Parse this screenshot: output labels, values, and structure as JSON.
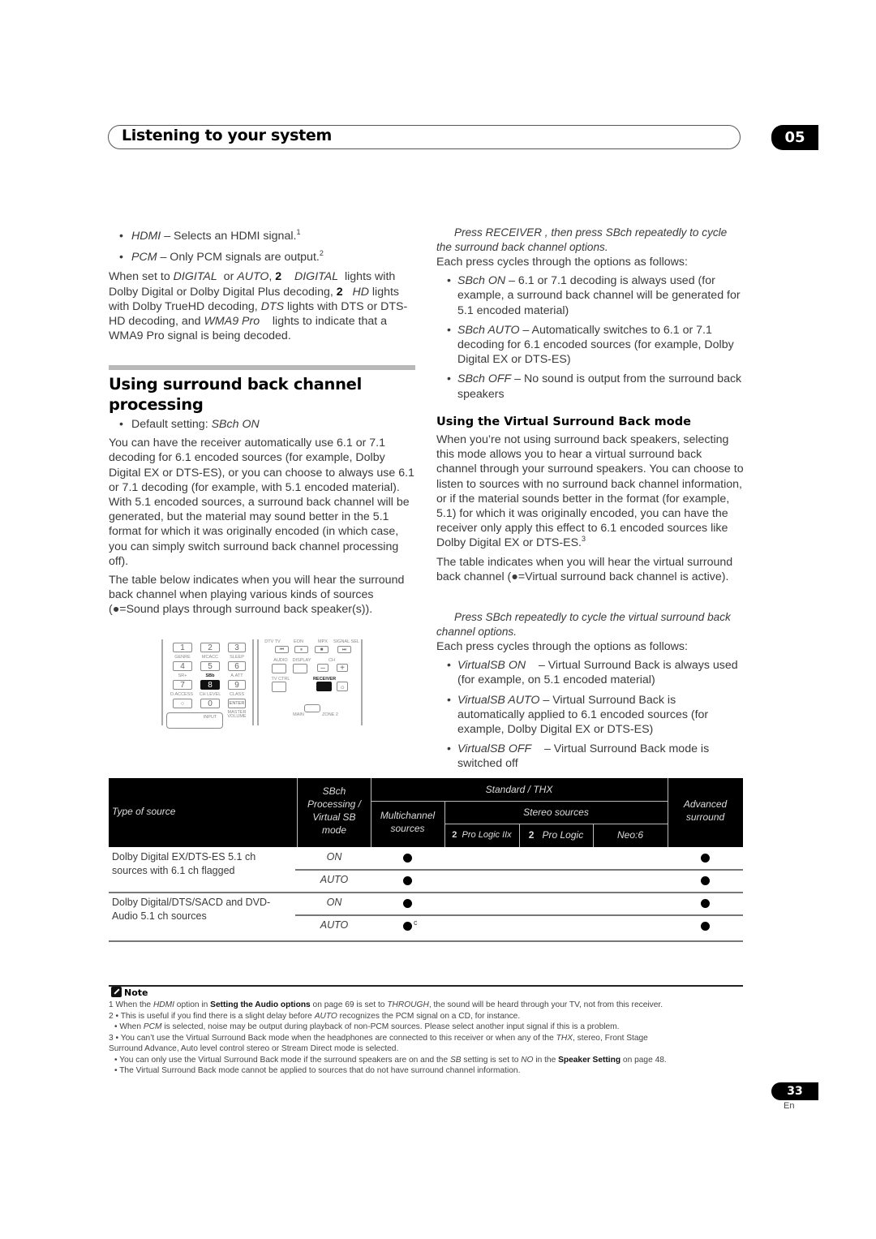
{
  "header": {
    "title": "Listening to your system",
    "chapter": "05"
  },
  "left": {
    "bullets_top": [
      {
        "term": "HDMI",
        "text": " – Selects an HDMI signal.",
        "sup": "1"
      },
      {
        "term": "PCM",
        "text": " – Only PCM signals are output.",
        "sup": "2"
      }
    ],
    "digital_para": {
      "p1": "When set to ",
      "t1": "DIGITAL",
      "p2": "  or ",
      "t2": "AUTO",
      "p3": ", ",
      "b1": "2",
      "p4": "    ",
      "t3": "DIGITAL",
      "p5": "  lights with Dolby Digital or Dolby Digital Plus decoding, ",
      "b2": "2",
      "p6": "   ",
      "t4": "HD",
      "p7": " lights with Dolby TrueHD decoding, ",
      "t5": "DTS",
      "p8": " lights with DTS or DTS-HD decoding, and ",
      "t6": "WMA9 Pro",
      "p9": "    lights to indicate that a WMA9 Pro signal is being decoded."
    },
    "section_title": "Using surround back channel processing",
    "default_setting_label": "Default setting: ",
    "default_setting_value": "SBch ON",
    "para1": "You can have the receiver automatically use 6.1 or 7.1 decoding for 6.1 encoded sources (for example, Dolby Digital EX or DTS-ES), or you can choose to always use 6.1 or 7.1 decoding (for example, with 5.1 encoded material). With 5.1 encoded sources, a surround back channel will be generated, but the material may sound better in the 5.1 format for which it was originally encoded (in which case, you can simply switch surround back channel processing off).",
    "para2": "The table below indicates when you will hear the surround back channel when playing various kinds of sources (●=Sound plays through surround back speaker(s))."
  },
  "remote": {
    "keys": [
      "1",
      "2",
      "3",
      "4",
      "5",
      "6",
      "7",
      "8",
      "9",
      "○",
      "0",
      "ENTER"
    ],
    "labels": [
      "GENRE",
      "MCACC",
      "SLEEP",
      "SR+",
      "SBb",
      "A.ATT",
      "D.ACCESS",
      "CH LEVEL",
      "CLASS",
      "INPUT",
      "MASTER VOLUME"
    ],
    "right_labels": [
      "DTV TV",
      "EON",
      "MPX",
      "SIGNAL SEL",
      "AUDIO",
      "DISPLAY",
      "CH",
      "TV CTRL",
      "RECEIVER",
      "MAIN",
      "ZONE 2"
    ],
    "transport_glyphs": [
      "⏮",
      "⏸",
      "■",
      "⏭"
    ],
    "ch_minus": "–",
    "ch_plus": "+",
    "light_icon": "☼"
  },
  "right": {
    "step1": {
      "p1": "Press ",
      "t1": "RECEIVER",
      "p2": " , then press ",
      "t2": "SBch",
      "p3": " repeatedly to cycle the surround back channel options."
    },
    "each_press": "Each press cycles through the options as follows:",
    "sbch_options": [
      {
        "term": "SBch ON",
        "text": "  – 6.1 or 7.1 decoding is always used (for example, a surround back channel will be generated for 5.1 encoded material)"
      },
      {
        "term": "SBch AUTO",
        "text": "  – Automatically switches to 6.1 or 7.1 decoding for 6.1 encoded sources (for example, Dolby Digital EX or DTS-ES)"
      },
      {
        "term": "SBch OFF",
        "text": "  – No sound is output from the surround back speakers"
      }
    ],
    "subsection_title": "Using the Virtual Surround Back mode",
    "vsb_para1": "When you’re not using surround back speakers, selecting this mode allows you to hear a virtual surround back channel through your surround speakers. You can choose to listen to sources with no surround back channel information, or if the material sounds better in the format (for example, 5.1) for which it was originally encoded, you can have the receiver only apply this effect to 6.1 encoded sources like Dolby Digital EX or DTS-ES.",
    "vsb_para1_sup": "3",
    "vsb_para2": "The table indicates when you will hear the virtual surround back channel (●=Virtual surround back channel is active).",
    "step2": {
      "p1": "Press ",
      "t1": "SBch",
      "p2": " repeatedly to cycle the virtual surround back channel options."
    },
    "each_press2": "Each press cycles through the options as follows:",
    "vsb_options": [
      {
        "term": "VirtualSB ON",
        "text": "    – Virtual Surround Back is always used (for example, on 5.1 encoded material)"
      },
      {
        "term": "VirtualSB AUTO",
        "text": " – Virtual Surround Back is automatically applied to 6.1 encoded sources (for example, Dolby Digital EX or DTS-ES)"
      },
      {
        "term": "VirtualSB OFF",
        "text": "    – Virtual Surround Back mode is switched off"
      }
    ]
  },
  "table": {
    "headers": {
      "type_of_source": "Type of source",
      "sbch_mode": [
        "SBch",
        "Processing /",
        "Virtual SB",
        "mode"
      ],
      "standard_thx": "Standard / THX",
      "multichannel": [
        "Multichannel",
        "sources"
      ],
      "stereo_sources": "Stereo sources",
      "pl2x_num": "2",
      "pl2x": "Pro Logic IIx",
      "pl_num": "2",
      "pl": "Pro Logic",
      "neo6": "Neo:6",
      "advanced": [
        "Advanced",
        "surround"
      ]
    },
    "groups": [
      {
        "source": [
          "Dolby Digital EX/DTS-ES 5.1 ch",
          "sources with 6.1 ch flagged"
        ],
        "rows": [
          {
            "mode": "ON",
            "multichannel": true,
            "multi_sup": "",
            "pl2x": false,
            "pl": false,
            "neo6": false,
            "advanced": true
          },
          {
            "mode": "AUTO",
            "multichannel": true,
            "multi_sup": "",
            "pl2x": false,
            "pl": false,
            "neo6": false,
            "advanced": true
          }
        ]
      },
      {
        "source": [
          "Dolby Digital/DTS/SACD and DVD-",
          "Audio 5.1 ch sources"
        ],
        "rows": [
          {
            "mode": "ON",
            "multichannel": true,
            "multi_sup": "",
            "pl2x": false,
            "pl": false,
            "neo6": false,
            "advanced": true
          },
          {
            "mode": "AUTO",
            "multichannel": true,
            "multi_sup": "c",
            "pl2x": false,
            "pl": false,
            "neo6": false,
            "advanced": true
          }
        ]
      }
    ]
  },
  "notes": {
    "title": "Note",
    "n1": {
      "a": "1 When the ",
      "t1": "HDMI",
      "b": " option in ",
      "bold": "Setting the Audio options",
      "c": " on page 69 is set to ",
      "t2": "THROUGH",
      "d": ", the sound will be heard through your TV, not from this receiver."
    },
    "n2a": {
      "a": "2 • This is useful if you find there is a slight delay before ",
      "t1": "AUTO",
      "b": " recognizes the PCM signal on a CD, for instance."
    },
    "n2b": {
      "a": "• When ",
      "t1": "PCM",
      "b": " is selected, noise may be output during playback of non-PCM sources. Please select another input signal if this is a problem."
    },
    "n3a": {
      "a": "3 • You can’t use the Virtual Surround Back mode when the headphones are connected to this receiver or when any of the ",
      "t1": "THX",
      "b": ", stereo, Front Stage"
    },
    "n3a2": "Surround Advance, Auto level control stereo or Stream Direct mode is selected.",
    "n3b": {
      "a": "• You can only use the Virtual Surround Back mode if the surround speakers are on and the ",
      "t1": "SB",
      "b": " setting is set to ",
      "t2": "NO",
      "c": " in the ",
      "bold": "Speaker Setting",
      "d": " on page 48."
    },
    "n3c": "• The Virtual Surround Back mode cannot be applied to sources that do not have surround channel information."
  },
  "footer": {
    "page": "33",
    "lang": "En"
  }
}
